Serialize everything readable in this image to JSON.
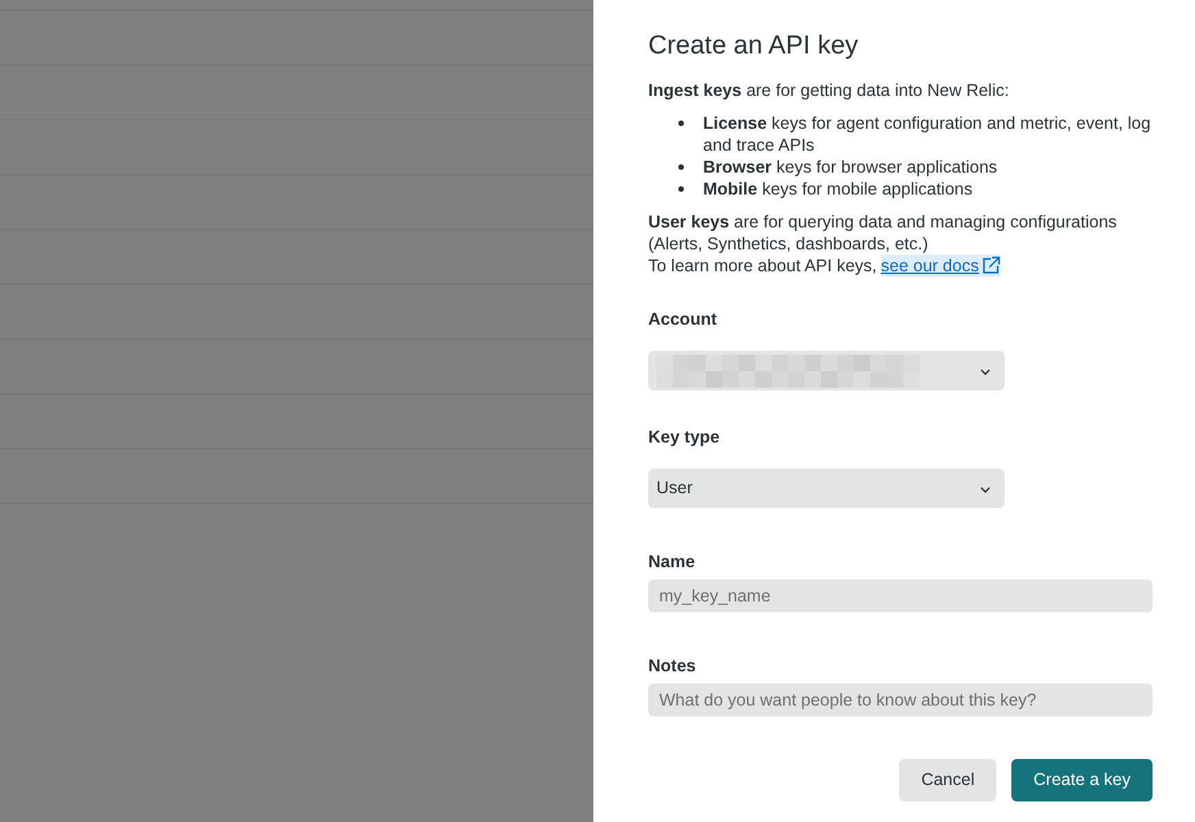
{
  "dialog": {
    "title": "Create an API key",
    "intro": "**Ingest keys** are for getting data into New Relic:",
    "bullets": [
      "**License** keys for agent configuration and metric, event, log and trace APIs",
      "**Browser** keys for browser applications",
      "**Mobile** keys for mobile applications"
    ],
    "user_keys": "**User keys** are for querying data and managing configurations (Alerts, Synthetics, dashboards, etc.)",
    "learn_more": "To learn more about API keys,",
    "docs_link": "see our docs",
    "fields": [
      {
        "kind": "select",
        "label": "Account",
        "redacted": true
      },
      {
        "kind": "select",
        "label": "Key type",
        "value": "User"
      },
      {
        "kind": "text",
        "label": "Name",
        "placeholder": "my_key_name"
      },
      {
        "kind": "text",
        "label": "Notes",
        "placeholder": "What do you want people to know about this key?"
      }
    ],
    "buttons": [
      {
        "label": "Cancel",
        "primary": false
      },
      {
        "label": "Create a key",
        "primary": true
      }
    ]
  }
}
